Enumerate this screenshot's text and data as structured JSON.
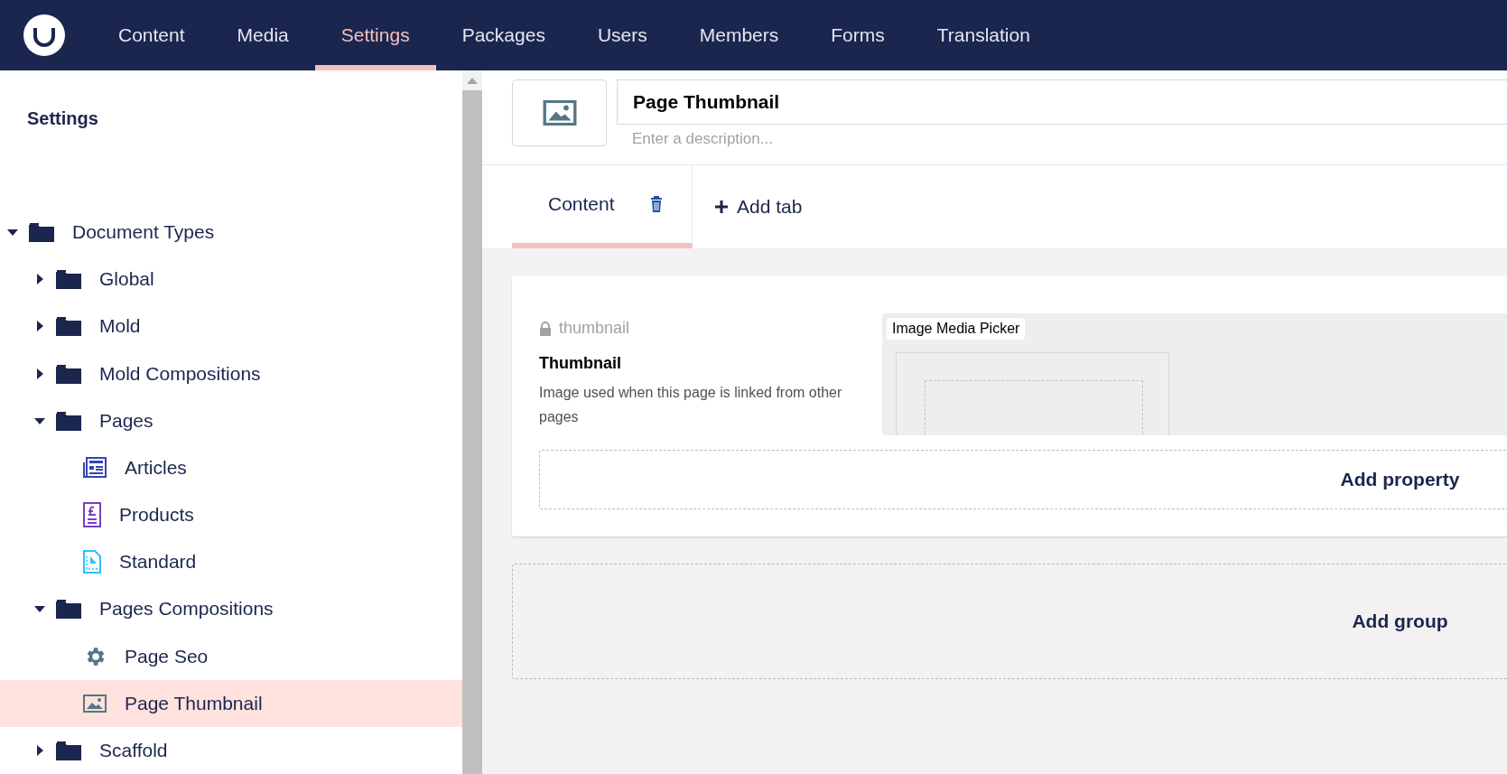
{
  "top_nav": {
    "items": [
      {
        "label": "Content",
        "selected": false
      },
      {
        "label": "Media",
        "selected": false
      },
      {
        "label": "Settings",
        "selected": true
      },
      {
        "label": "Packages",
        "selected": false
      },
      {
        "label": "Users",
        "selected": false
      },
      {
        "label": "Members",
        "selected": false
      },
      {
        "label": "Forms",
        "selected": false
      },
      {
        "label": "Translation",
        "selected": false
      }
    ]
  },
  "sidebar": {
    "title": "Settings",
    "tree": [
      {
        "label": "Document Types",
        "kind": "folder",
        "expanded": true,
        "selected": false,
        "children": [
          {
            "label": "Global",
            "kind": "folder",
            "expanded": false,
            "selected": false
          },
          {
            "label": "Mold",
            "kind": "folder",
            "expanded": false,
            "selected": false
          },
          {
            "label": "Mold Compositions",
            "kind": "folder",
            "expanded": false,
            "selected": false
          },
          {
            "label": "Pages",
            "kind": "folder",
            "expanded": true,
            "selected": false,
            "children": [
              {
                "label": "Articles",
                "kind": "newspaper",
                "selected": false
              },
              {
                "label": "Products",
                "kind": "receipt",
                "selected": false
              },
              {
                "label": "Standard",
                "kind": "document",
                "selected": false
              }
            ]
          },
          {
            "label": "Pages Compositions",
            "kind": "folder",
            "expanded": true,
            "selected": false,
            "children": [
              {
                "label": "Page Seo",
                "kind": "gear",
                "selected": false
              },
              {
                "label": "Page Thumbnail",
                "kind": "picture",
                "selected": true
              }
            ]
          },
          {
            "label": "Scaffold",
            "kind": "folder",
            "expanded": false,
            "selected": false
          }
        ]
      }
    ]
  },
  "editor": {
    "name": "Page Thumbnail",
    "description_placeholder": "Enter a description...",
    "tabs": [
      {
        "label": "Content",
        "selected": true
      }
    ],
    "add_tab": "Add tab",
    "groups": [
      {
        "properties": [
          {
            "alias": "thumbnail",
            "locked": true,
            "label": "Thumbnail",
            "description": "Image used when this page is linked from other pages",
            "editor": "Image Media Picker"
          }
        ],
        "add_property": "Add property"
      }
    ],
    "add_group": "Add group"
  }
}
